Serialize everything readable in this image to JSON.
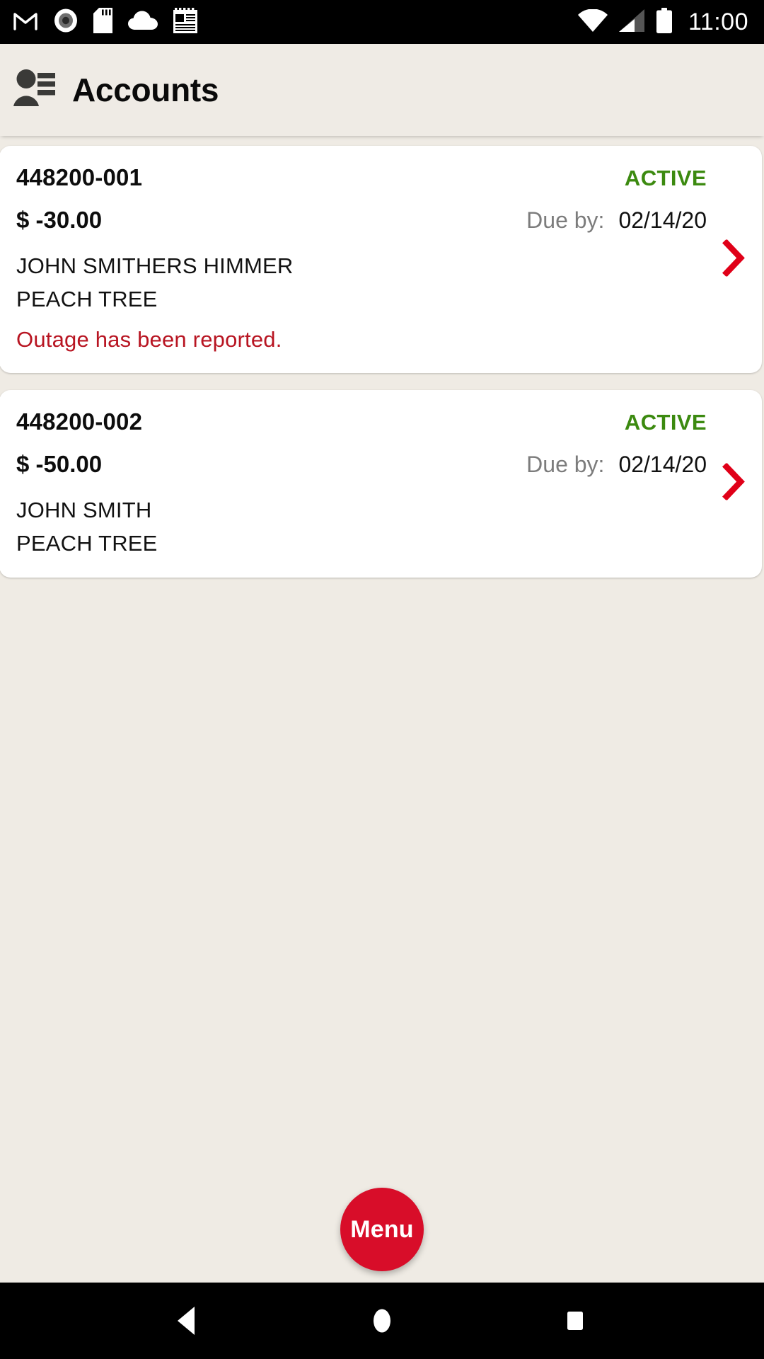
{
  "status_bar": {
    "time": "11:00",
    "left_icons": [
      {
        "name": "gmail-icon",
        "label": "M"
      },
      {
        "name": "record-dot-icon",
        "label": ""
      },
      {
        "name": "sd-card-icon",
        "label": ""
      },
      {
        "name": "cloud-icon",
        "label": ""
      },
      {
        "name": "notepad-icon",
        "label": ""
      }
    ],
    "right_icons": [
      {
        "name": "wifi-icon",
        "label": ""
      },
      {
        "name": "cellular-signal-icon",
        "label": ""
      },
      {
        "name": "battery-icon",
        "label": ""
      }
    ]
  },
  "app_bar": {
    "title": "Accounts",
    "icon": "accounts-contact-icon"
  },
  "colors": {
    "background": "#EFEBE4",
    "app_bar": "#EFEBE5",
    "card": "#FFFFFF",
    "status_active": "#3C8A10",
    "notice_red": "#B81522",
    "chevron_red": "#E00018",
    "fab_red": "#D80D29",
    "due_label_gray": "#7C7C7C"
  },
  "accounts": [
    {
      "number": "448200-001",
      "status": "ACTIVE",
      "amount": "$ -30.00",
      "due_label": "Due by:",
      "due_date": "02/14/20",
      "customer_name": "JOHN SMITHERS HIMMER",
      "address": "PEACH TREE",
      "notice": "Outage has been reported.",
      "chevron": "chevron-right-icon"
    },
    {
      "number": "448200-002",
      "status": "ACTIVE",
      "amount": "$ -50.00",
      "due_label": "Due by:",
      "due_date": "02/14/20",
      "customer_name": "JOHN SMITH",
      "address": "PEACH TREE",
      "notice": "",
      "chevron": "chevron-right-icon"
    }
  ],
  "fab": {
    "label": "Menu"
  },
  "nav_bar": {
    "back": "back-nav-icon",
    "home": "home-nav-icon",
    "recents": "recents-nav-icon"
  }
}
